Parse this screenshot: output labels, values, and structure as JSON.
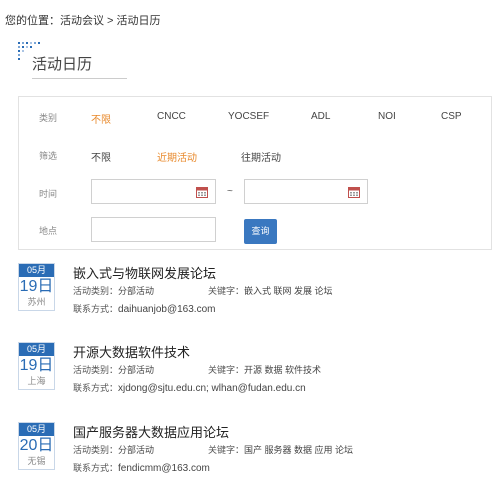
{
  "breadcrumb": {
    "prefix": "您的位置：",
    "section": "活动会议",
    "separator": " > ",
    "current": "活动日历"
  },
  "page": {
    "title": "活动日历"
  },
  "filters": {
    "category": {
      "label": "类别",
      "options": [
        "不限",
        "CNCC",
        "YOCSEF",
        "ADL",
        "NOI",
        "CSP"
      ],
      "selected": "不限"
    },
    "status": {
      "label": "筛选",
      "options": [
        "不限",
        "近期活动",
        "往期活动"
      ],
      "selected": "近期活动"
    },
    "time": {
      "label": "时间",
      "start_value": "",
      "separator": "~",
      "end_value": ""
    },
    "place": {
      "label": "地点",
      "value": ""
    },
    "search_label": "查询"
  },
  "events": [
    {
      "month": "05月",
      "day": "19日",
      "city": "苏州",
      "title": "嵌入式与物联网发展论坛",
      "type_label": "活动类别：",
      "type": "分部活动",
      "keywords_label": "关键字：",
      "keywords": "嵌入式 联网 发展 论坛",
      "contact_label": "联系方式：",
      "contact": "daihuanjob@163.com"
    },
    {
      "month": "05月",
      "day": "19日",
      "city": "上海",
      "title": "开源大数据软件技术",
      "type_label": "活动类别：",
      "type": "分部活动",
      "keywords_label": "关键字：",
      "keywords": "开源 数据 软件技术",
      "contact_label": "联系方式：",
      "contact": "xjdong@sjtu.edu.cn; wlhan@fudan.edu.cn"
    },
    {
      "month": "05月",
      "day": "20日",
      "city": "无锡",
      "title": "国产服务器大数据应用论坛",
      "type_label": "活动类别：",
      "type": "分部活动",
      "keywords_label": "关键字：",
      "keywords": "国产 服务器 数据 应用 论坛",
      "contact_label": "联系方式：",
      "contact": "fendicmm@163.com"
    }
  ],
  "colors": {
    "accent": "#e8892b",
    "brand_blue": "#2a6cb5",
    "button_blue": "#3a78c0"
  }
}
